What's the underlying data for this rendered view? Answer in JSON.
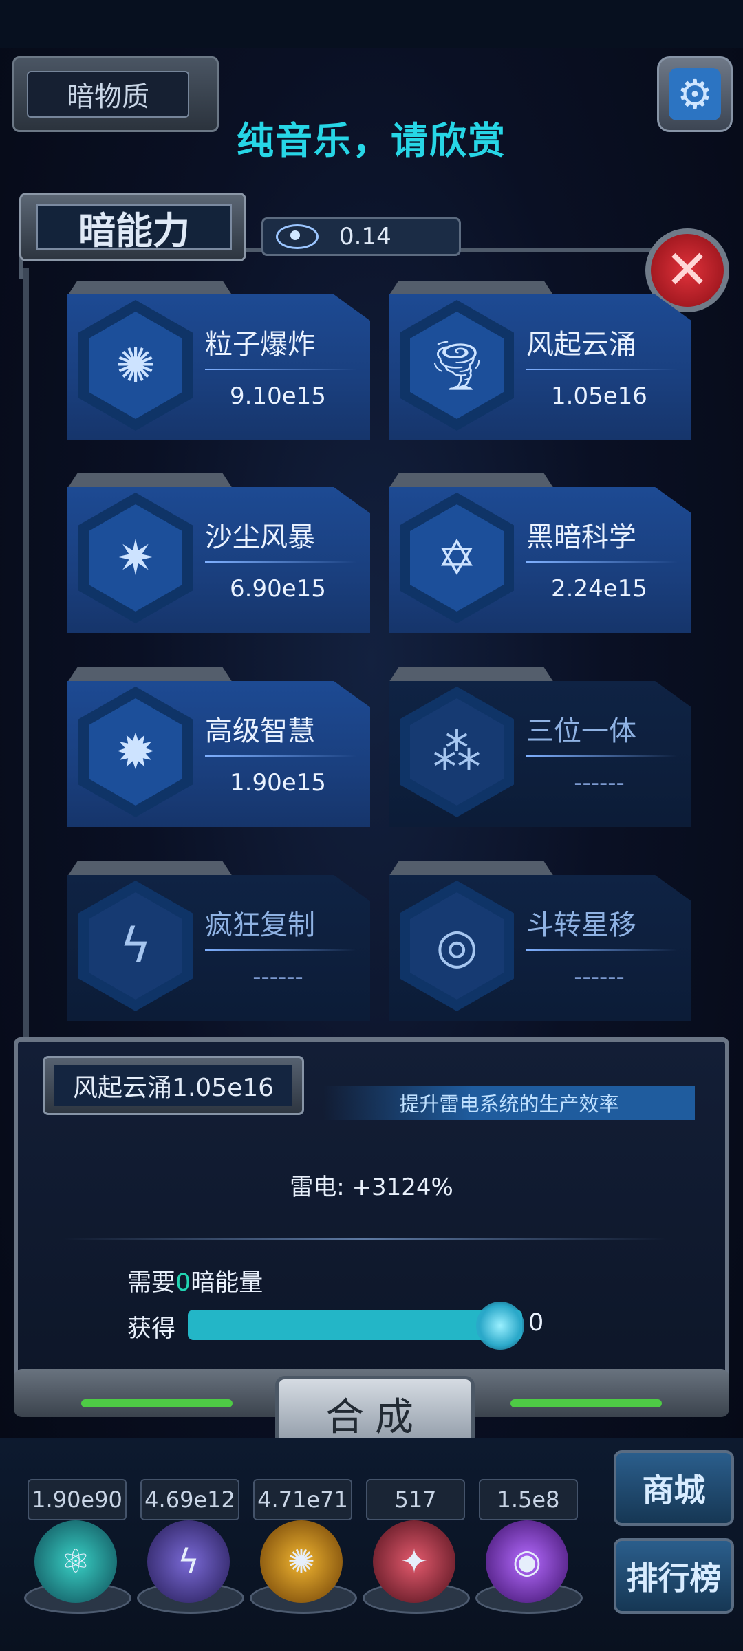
{
  "header": {
    "tab_label": "暗物质",
    "notice": "纯音乐，请欣赏",
    "settings_icon": "gear-icon"
  },
  "ability_panel": {
    "title": "暗能力",
    "count_icon": "galaxy-icon",
    "count_value": "0.14",
    "close_icon": "close-icon"
  },
  "skills": [
    {
      "name": "粒子爆炸",
      "value": "9.10e15",
      "icon": "explosion-icon",
      "unlocked": true
    },
    {
      "name": "风起云涌",
      "value": "1.05e16",
      "icon": "tornado-icon",
      "unlocked": true
    },
    {
      "name": "沙尘风暴",
      "value": "6.90e15",
      "icon": "sandstorm-icon",
      "unlocked": true
    },
    {
      "name": "黑暗科学",
      "value": "2.24e15",
      "icon": "hexagram-icon",
      "unlocked": true
    },
    {
      "name": "高级智慧",
      "value": "1.90e15",
      "icon": "brain-icon",
      "unlocked": true
    },
    {
      "name": "三位一体",
      "value": "------",
      "icon": "trinity-icon",
      "unlocked": false
    },
    {
      "name": "疯狂复制",
      "value": "------",
      "icon": "lightning-arrows-icon",
      "unlocked": false
    },
    {
      "name": "斗转星移",
      "value": "------",
      "icon": "vortex-icon",
      "unlocked": false
    }
  ],
  "detail": {
    "selected": "风起云涌1.05e16",
    "description": "提升雷电系统的生产效率",
    "effect": "雷电: +3124%",
    "need_prefix": "需要",
    "need_amount": "0",
    "need_suffix": "暗能量",
    "obtain_label": "获得",
    "obtain_value": "0",
    "slider_fraction": 1.0,
    "merge_label": "合成"
  },
  "resources": [
    {
      "value": "1.90e90",
      "icon": "atom-orb-icon",
      "color": "#1fa6a0"
    },
    {
      "value": "4.69e12",
      "icon": "thunder-orb-icon",
      "color": "#5a4fb0"
    },
    {
      "value": "4.71e71",
      "icon": "fire-orb-icon",
      "color": "#c68a1c"
    },
    {
      "value": "517",
      "icon": "crystal-orb-icon",
      "color": "#b33a4a"
    },
    {
      "value": "1.5e8",
      "icon": "vortex-orb-icon",
      "color": "#7a3db5"
    }
  ],
  "side_buttons": {
    "shop": "商城",
    "ranking": "排行榜"
  },
  "colors": {
    "accent_cyan": "#27d6e6",
    "progress_green": "#4ecb45",
    "need_number": "#21d4b2"
  }
}
